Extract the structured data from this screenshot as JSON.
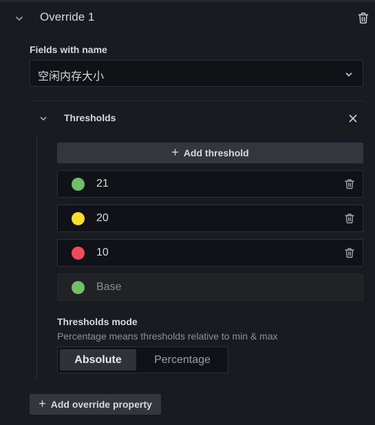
{
  "override": {
    "title": "Override 1",
    "chevron_icon": "chevron-down-icon",
    "delete_icon": "trash-icon"
  },
  "fields_with_name": {
    "label": "Fields with name",
    "value": "空闲内存大小",
    "dropdown_icon": "chevron-down-icon"
  },
  "thresholds": {
    "title": "Thresholds",
    "add_label": "Add threshold",
    "close_icon": "close-icon",
    "steps": [
      {
        "value": "21",
        "color": "#73bf69"
      },
      {
        "value": "20",
        "color": "#fade2a"
      },
      {
        "value": "10",
        "color": "#f2495c"
      },
      {
        "value": "Base",
        "color": "#73bf69"
      }
    ],
    "mode": {
      "label": "Thresholds mode",
      "description": "Percentage means thresholds relative to min & max",
      "options": [
        "Absolute",
        "Percentage"
      ],
      "selected": "Absolute"
    }
  },
  "add_override_property_label": "Add override property"
}
